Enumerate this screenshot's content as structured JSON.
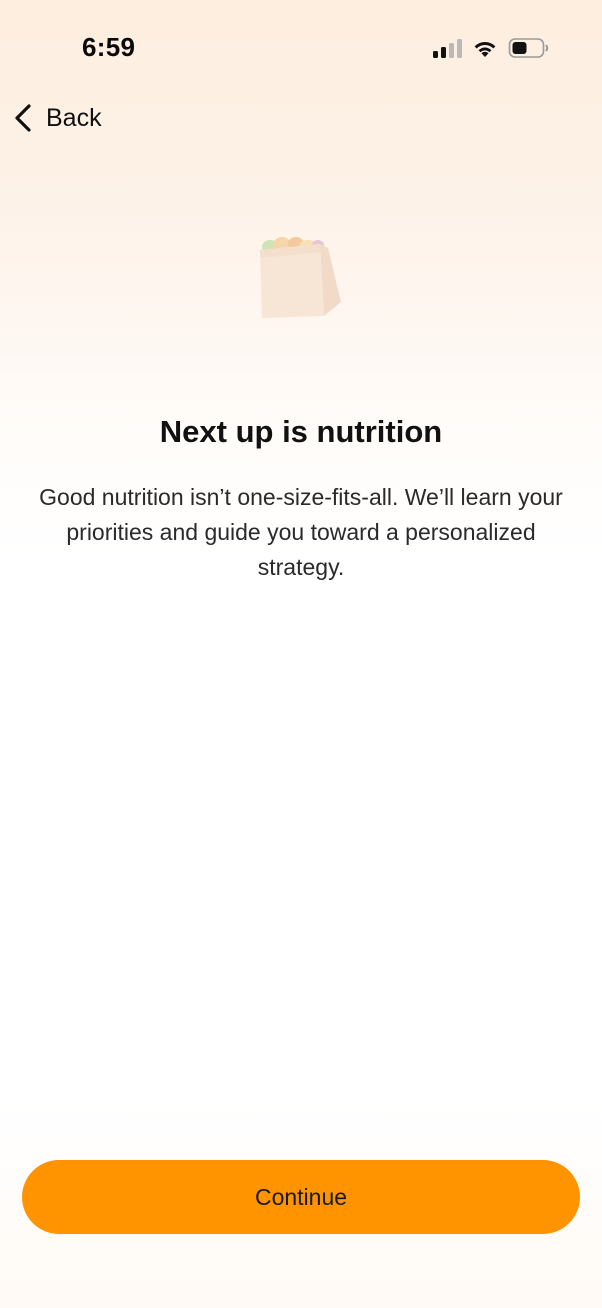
{
  "status_bar": {
    "time": "6:59",
    "icons": [
      "signal-icon",
      "wifi-icon",
      "battery-icon"
    ]
  },
  "nav": {
    "back_label": "Back",
    "back_icon": "chevron-left-icon"
  },
  "illustration": {
    "icon": "grocery-bag-icon"
  },
  "content": {
    "title": "Next up is nutrition",
    "description": "Good nutrition isn’t one-size-fits-all. We’ll learn your priorities and guide you toward a personalized strategy."
  },
  "actions": {
    "continue_label": "Continue"
  },
  "colors": {
    "accent": "#ff9300",
    "background_top": "#fdeedf",
    "text": "#111111"
  }
}
